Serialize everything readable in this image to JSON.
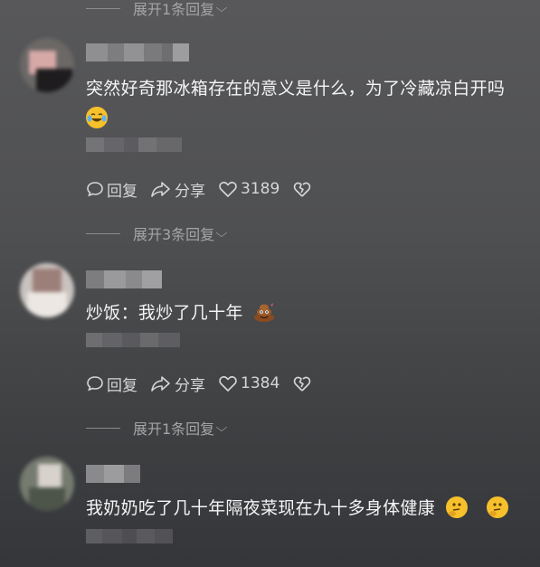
{
  "expand_top": {
    "text": "展开1条回复"
  },
  "comments": [
    {
      "text": "突然好奇那冰箱存在的意义是什么，为了冷藏凉白开吗",
      "emoji": "crying-laughing-emoji",
      "actions": {
        "reply": "回复",
        "share": "分享",
        "likes": "3189"
      },
      "expand": "展开3条回复"
    },
    {
      "text": "炒饭：我炒了几十年",
      "emoji": "poop-emoji",
      "actions": {
        "reply": "回复",
        "share": "分享",
        "likes": "1384"
      },
      "expand": "展开1条回复"
    },
    {
      "text": "我奶奶吃了几十年隔夜菜现在九十多身体健康",
      "emoji": "thinking-face-emoji"
    }
  ],
  "colors": {
    "text_primary": "#f4f4f4",
    "text_secondary": "#a5a5a8",
    "action_color": "#d6d6d8",
    "emoji_yellow": "#f7c12b",
    "poop_brown": "#8a4b23"
  }
}
